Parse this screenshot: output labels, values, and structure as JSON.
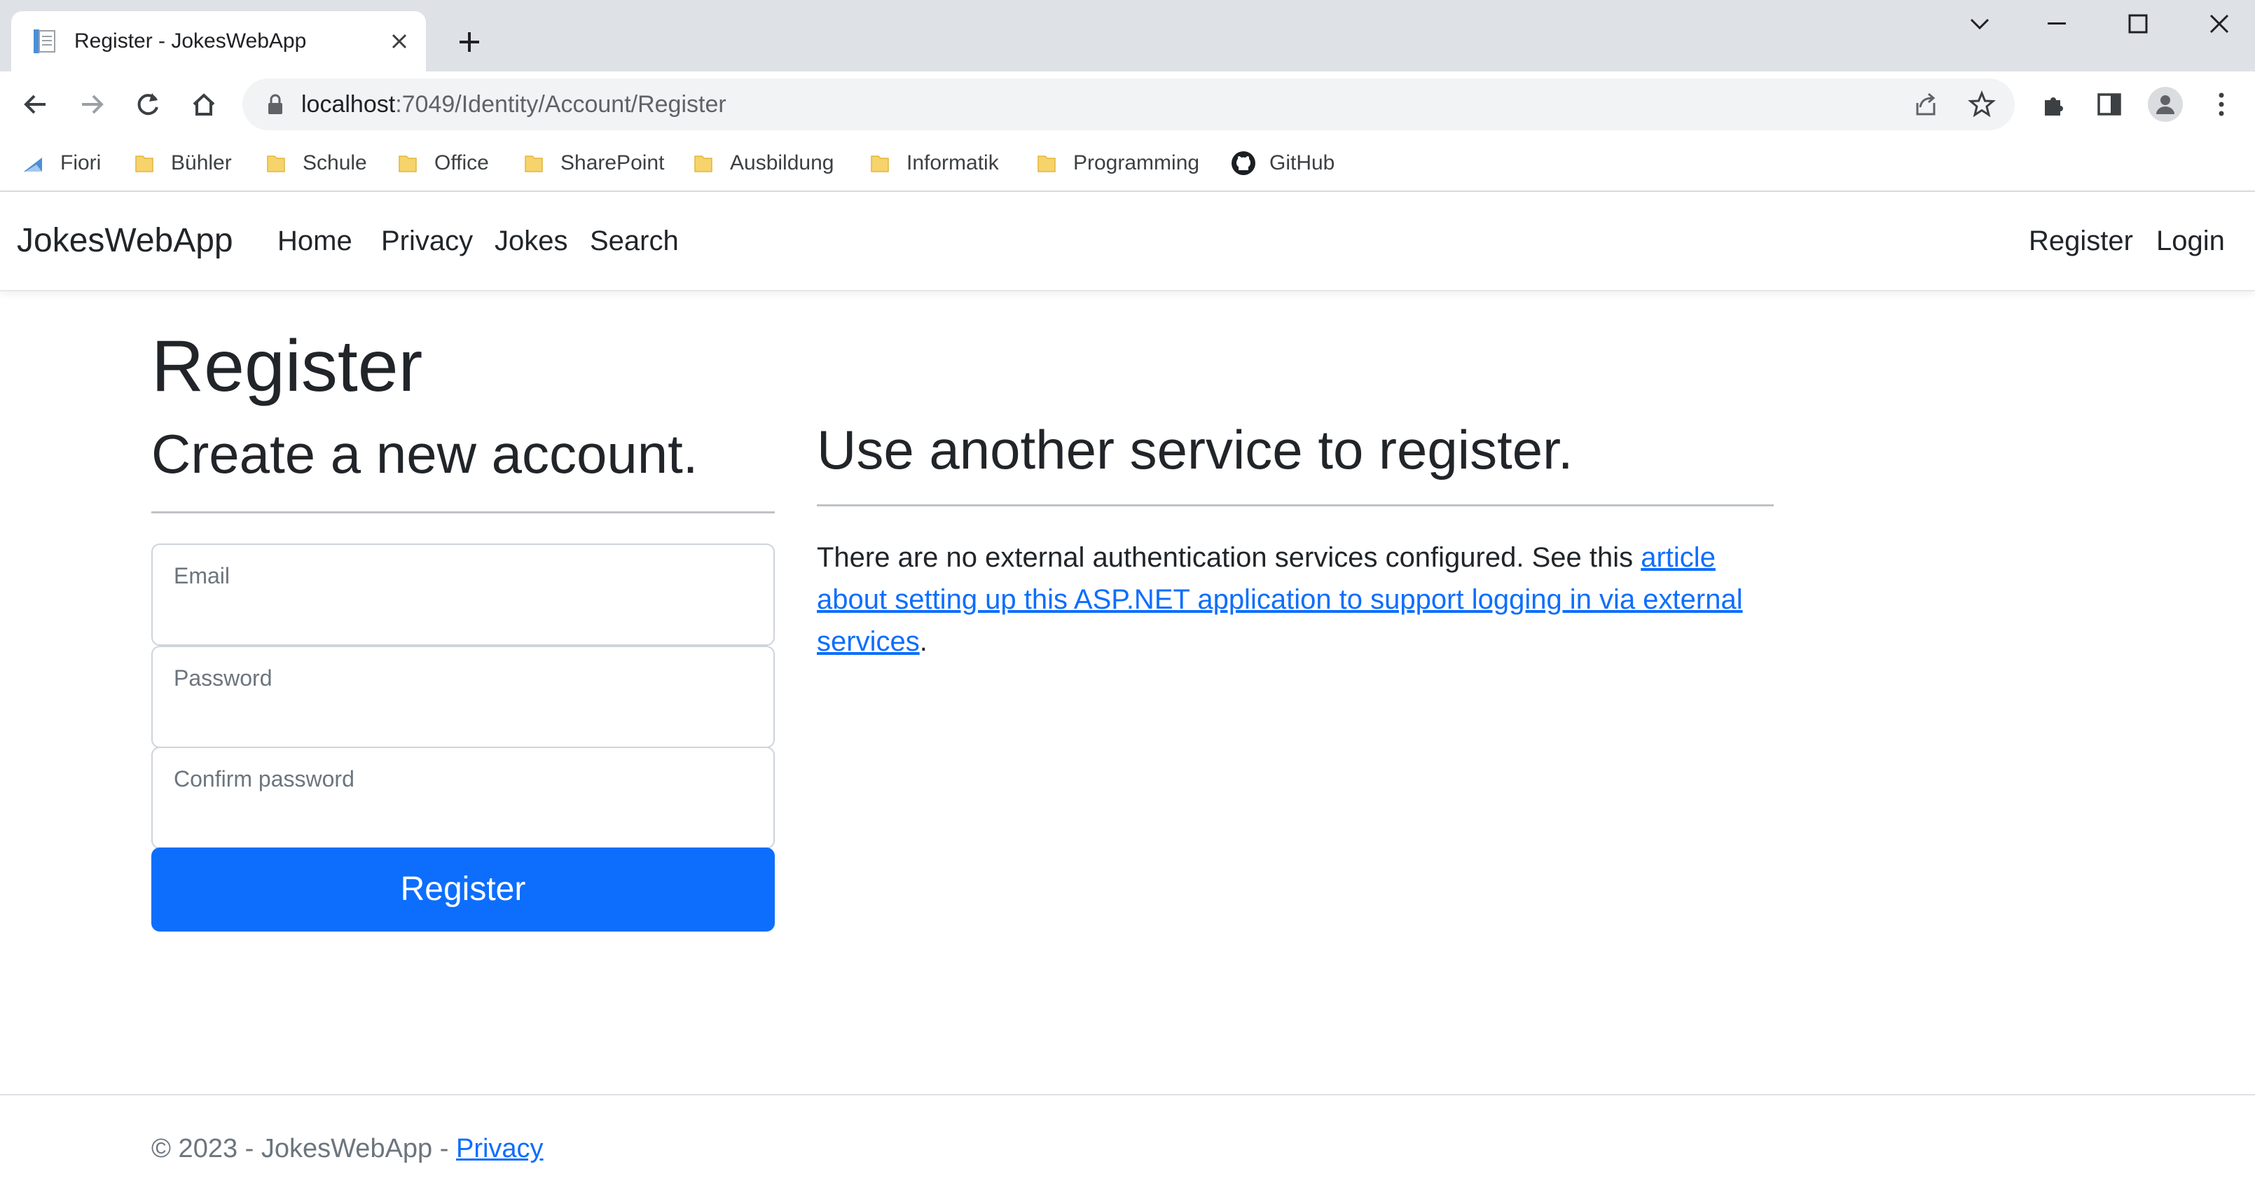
{
  "browser": {
    "tab_title": "Register - JokesWebApp",
    "url_host": "localhost",
    "url_rest": ":7049/Identity/Account/Register",
    "bookmarks": [
      "Fiori",
      "Bühler",
      "Schule",
      "Office",
      "SharePoint",
      "Ausbildung",
      "Informatik",
      "Programming",
      "GitHub"
    ]
  },
  "navbar": {
    "brand": "JokesWebApp",
    "links": [
      "Home",
      "Privacy",
      "Jokes",
      "Search"
    ],
    "right_links": [
      "Register",
      "Login"
    ]
  },
  "page": {
    "title": "Register",
    "subtitle": "Create a new account.",
    "fields": [
      "Email",
      "Password",
      "Confirm password"
    ],
    "submit_label": "Register",
    "external_title": "Use another service to register.",
    "external_text": "There are no external authentication services configured. See this ",
    "external_link": "article about setting up this ASP.NET application to support logging in via external services",
    "external_end": "."
  },
  "footer": {
    "text": "© 2023 - JokesWebApp - ",
    "link": "Privacy"
  },
  "colors": {
    "primary": "#0d6efd",
    "tabstrip": "#dee1e6",
    "omnibox": "#f1f3f4"
  }
}
